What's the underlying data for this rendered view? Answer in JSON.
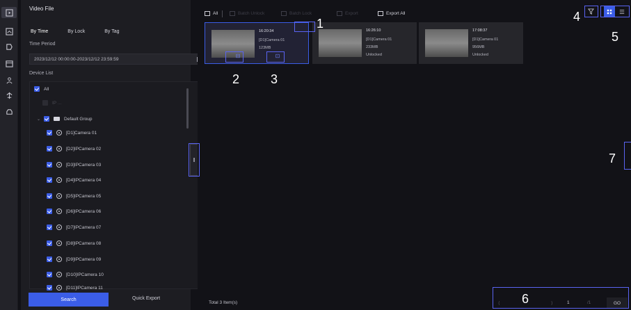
{
  "rail": {
    "icons": [
      "playback-icon",
      "picture-icon",
      "tag-icon",
      "event-icon",
      "people-icon",
      "smart-icon",
      "vehicle-icon"
    ]
  },
  "panel": {
    "title": "Video File",
    "tabs": [
      "By Time",
      "By Lock",
      "By Tag"
    ],
    "time_period_label": "Time Period",
    "time_period_value": "2023/12/12 00:00:00-2023/12/12 23:59:59",
    "device_list_label": "Device List",
    "all_label": "All",
    "dimmed_row": "IP ...",
    "group_label": "Default Group",
    "cameras": [
      "[D1]Camera 01",
      "[D2]IPCamera 02",
      "[D3]IPCamera 03",
      "[D4]IPCamera 04",
      "[D5]IPCamera 05",
      "[D6]IPCamera 06",
      "[D7]IPCamera 07",
      "[D8]IPCamera 08",
      "[D9]IPCamera 09",
      "[D10]IPCamera 10",
      "[D11]IPCamera 11"
    ],
    "search_label": "Search",
    "quick_export_label": "Quick Export"
  },
  "toolbar": {
    "all_label": "All",
    "batch_unlock": "Batch Unlock",
    "batch_lock": "Batch Lock",
    "export": "Export",
    "export_all": "Export All"
  },
  "cards": [
    {
      "time": "16:20:34",
      "camera": "[D1]Camera 01",
      "size": "123MB",
      "status": ""
    },
    {
      "time": "16:26:10",
      "camera": "[D1]Camera 01",
      "size": "233MB",
      "status": "Unlocked"
    },
    {
      "time": "17:08:37",
      "camera": "[D1]Camera 01",
      "size": "956MB",
      "status": "Unlocked"
    }
  ],
  "footer": {
    "total": "Total 3 Item(s)",
    "page_current": "1",
    "page_total": "/1",
    "goto_label": "GO"
  },
  "annotations": [
    "1",
    "2",
    "3",
    "4",
    "5",
    "6",
    "7"
  ],
  "colors": {
    "accent": "#3b5de7",
    "annotation": "#5a64f2"
  }
}
